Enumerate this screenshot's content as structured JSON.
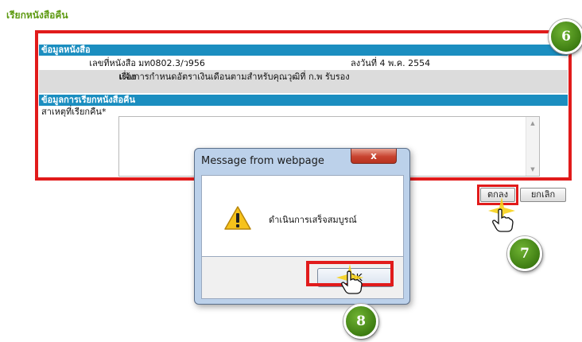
{
  "page": {
    "title": "เรียกหนังสือคืน"
  },
  "book_info": {
    "header": "ข้อมูลหนังสือ",
    "number_label": "เลขที่หนังสือ",
    "number_value": "มท0802.3/ว956",
    "date_text": "ลงวันที่ 4 พ.ค. 2554",
    "subject_label": "เรื่อง",
    "subject_value": "แจ้งการกำหนดอัตราเงินเดือนตามสำหรับคุณวุฒิที่ ก.พ รับรอง"
  },
  "recall_info": {
    "header": "ข้อมูลการเรียกหนังสือคืน",
    "reason_label": "สาเหตุที่เรียกคืน*",
    "reason_value": ""
  },
  "buttons": {
    "confirm": "ตกลง",
    "cancel": "ยกเลิก"
  },
  "dialog": {
    "title": "Message from webpage",
    "close": "x",
    "message": "ดำเนินการเสร็จสมบูรณ์",
    "ok": "OK"
  },
  "steps": {
    "six": "6",
    "seven": "7",
    "eight": "8"
  },
  "colors": {
    "title_green": "#5e9a12",
    "header_blue": "#1b8ec0",
    "highlight_red": "#e11b1b",
    "badge_green": "#4a8c16"
  },
  "icons": {
    "warning": "warning-icon",
    "cursor": "hand-cursor-icon",
    "scroll_up": "scroll-up-icon",
    "scroll_down": "scroll-down-icon"
  }
}
